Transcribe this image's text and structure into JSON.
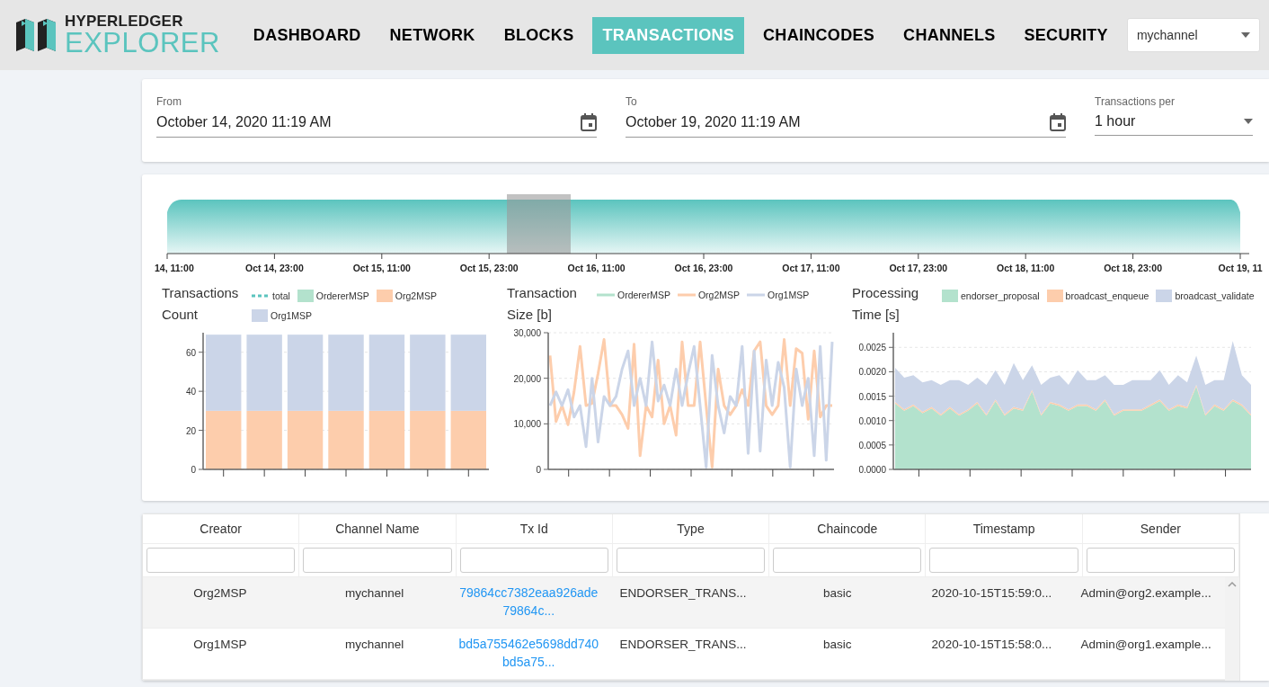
{
  "header": {
    "logo": {
      "top": "HYPERLEDGER",
      "bottom": "EXPLORER"
    },
    "nav": [
      {
        "label": "DASHBOARD",
        "selected": false
      },
      {
        "label": "NETWORK",
        "selected": false
      },
      {
        "label": "BLOCKS",
        "selected": false
      },
      {
        "label": "TRANSACTIONS",
        "selected": true
      },
      {
        "label": "CHAINCODES",
        "selected": false
      },
      {
        "label": "CHANNELS",
        "selected": false
      },
      {
        "label": "SECURITY",
        "selected": false
      }
    ],
    "channel_select": {
      "value": "mychannel"
    }
  },
  "filters": {
    "from": {
      "label": "From",
      "value": "October 14, 2020 11:19 AM"
    },
    "to": {
      "label": "To",
      "value": "October 19, 2020 11:19 AM"
    },
    "per": {
      "label": "Transactions per",
      "value": "1 hour"
    }
  },
  "timeline": {
    "ticks": [
      "14, 11:00",
      "Oct 14, 23:00",
      "Oct 15, 11:00",
      "Oct 15, 23:00",
      "Oct 16, 11:00",
      "Oct 16, 23:00",
      "Oct 17, 11:00",
      "Oct 17, 23:00",
      "Oct 18, 11:00",
      "Oct 18, 23:00",
      "Oct 19, 11"
    ]
  },
  "charts": [
    {
      "chart_data": {
        "type": "bar",
        "title": "Transactions Count",
        "stacked": true,
        "grid": true,
        "legend": "top",
        "ylim": [
          0,
          70
        ],
        "yticks": [
          0,
          20,
          40,
          60
        ],
        "ref_lines": [
          {
            "label": "total",
            "color": "#5bc4be"
          }
        ],
        "series": [
          {
            "name": "OrdererMSP",
            "color": "#b3e2cd",
            "values": [
              0,
              0,
              0,
              0,
              0,
              0,
              0
            ]
          },
          {
            "name": "Org2MSP",
            "color": "#fdcdac",
            "values": [
              30,
              30,
              30,
              30,
              30,
              30,
              30
            ]
          },
          {
            "name": "Org1MSP",
            "color": "#cbd5e8",
            "values": [
              39,
              39,
              39,
              39,
              39,
              39,
              39
            ]
          }
        ]
      }
    },
    {
      "chart_data": {
        "type": "line",
        "title": "Transaction Size [b]",
        "grid": true,
        "legend": "top",
        "ylim": [
          0,
          30000
        ],
        "yticks": [
          {
            "value": 0,
            "label": "0"
          },
          {
            "value": 10000,
            "label": "10,000"
          },
          {
            "value": 20000,
            "label": "20,000"
          },
          {
            "value": 30000,
            "label": "30,000"
          }
        ],
        "series": [
          {
            "name": "OrdererMSP",
            "color": "#b3e2cd",
            "values": [
              null,
              null,
              null,
              null,
              null,
              null,
              null,
              null,
              null,
              null,
              null,
              null,
              null,
              null,
              null,
              null,
              null,
              null,
              null,
              null,
              null,
              null,
              null,
              null,
              null,
              null,
              null,
              null,
              null,
              null,
              null,
              null,
              null,
              null,
              null,
              null,
              null,
              null,
              null,
              null,
              null,
              null,
              null,
              null,
              null,
              null,
              null,
              null
            ]
          },
          {
            "name": "Org2MSP",
            "color": "#fdcdac",
            "values": [
              25000,
              10500,
              14000,
              9800,
              17000,
              27000,
              14000,
              14500,
              21000,
              28500,
              14000,
              14000,
              12000,
              9000,
              27500,
              3000,
              14000,
              11500,
              24000,
              10000,
              14000,
              7500,
              28000,
              14000,
              14000,
              28000,
              14000,
              500,
              22000,
              14000,
              12000,
              14000,
              17500,
              14000,
              26000,
              28000,
              14000,
              12000,
              14000,
              28500,
              14000,
              26500,
              25500,
              11000,
              26000,
              11500,
              14000,
              14000
            ]
          },
          {
            "name": "Org1MSP",
            "color": "#cbd5e8",
            "values": [
              14000,
              17000,
              14000,
              17500,
              11500,
              14000,
              5000,
              20000,
              6000,
              16000,
              14000,
              16000,
              22000,
              26000,
              14000,
              20000,
              14000,
              28000,
              15000,
              18500,
              14000,
              22000,
              14000,
              21000,
              27000,
              14000,
              500,
              25000,
              14000,
              8000,
              16000,
              14000,
              27000,
              3500,
              26000,
              4000,
              24000,
              14000,
              23500,
              18000,
              500,
              22000,
              14000,
              20000,
              3000,
              27000,
              2000,
              28000
            ]
          }
        ]
      }
    },
    {
      "chart_data": {
        "type": "area",
        "title": "Processing Time [s]",
        "stacked": true,
        "grid": true,
        "legend": "top",
        "ylim": [
          0,
          0.0028
        ],
        "yticks": [
          {
            "value": 0,
            "label": "0.0000"
          },
          {
            "value": 0.0005,
            "label": "0.0005"
          },
          {
            "value": 0.001,
            "label": "0.0010"
          },
          {
            "value": 0.0015,
            "label": "0.0015"
          },
          {
            "value": 0.002,
            "label": "0.0020"
          },
          {
            "value": 0.0025,
            "label": "0.0025"
          }
        ],
        "series": [
          {
            "name": "endorser_proposal",
            "color": "#b3e2cd",
            "values": [
              0.00135,
              0.0012,
              0.0013,
              0.00115,
              0.00125,
              0.0011,
              0.00125,
              0.0011,
              0.0012,
              0.00135,
              0.0011,
              0.0014,
              0.0011,
              0.00125,
              0.0012,
              0.0016,
              0.0011,
              0.00135,
              0.0013,
              0.0012,
              0.0013,
              0.0013,
              0.0012,
              0.0014,
              0.0011,
              0.0012,
              0.0012,
              0.0012,
              0.0013,
              0.0014,
              0.0012,
              0.0013,
              0.00125,
              0.0017,
              0.0011,
              0.0013,
              0.0012,
              0.0014,
              0.0013,
              0.0011
            ]
          },
          {
            "name": "broadcast_enqueue",
            "color": "#fdcdac",
            "values": [
              3e-05,
              3e-05,
              3e-05,
              3e-05,
              3e-05,
              3e-05,
              3e-05,
              3e-05,
              3e-05,
              3e-05,
              3e-05,
              3e-05,
              3e-05,
              3e-05,
              3e-05,
              3e-05,
              3e-05,
              3e-05,
              3e-05,
              3e-05,
              3e-05,
              3e-05,
              3e-05,
              3e-05,
              3e-05,
              3e-05,
              3e-05,
              3e-05,
              3e-05,
              3e-05,
              3e-05,
              3e-05,
              3e-05,
              3e-05,
              3e-05,
              3e-05,
              3e-05,
              3e-05,
              3e-05,
              3e-05
            ]
          },
          {
            "name": "broadcast_validate",
            "color": "#cbd5e8",
            "values": [
              0.0007,
              0.00065,
              0.0006,
              0.0006,
              0.00055,
              0.0006,
              0.00055,
              0.0007,
              0.0005,
              0.0005,
              0.0006,
              0.0006,
              0.0006,
              0.0009,
              0.0006,
              0.0005,
              0.0006,
              0.0005,
              0.0006,
              0.0005,
              0.0007,
              0.0005,
              0.0006,
              0.0005,
              0.0006,
              0.0005,
              0.0006,
              0.0006,
              0.0005,
              0.0006,
              0.0005,
              0.0006,
              0.0005,
              0.0006,
              0.0006,
              0.0005,
              0.0006,
              0.0012,
              0.0006,
              0.0006
            ]
          }
        ]
      }
    }
  ],
  "table": {
    "columns": [
      "Creator",
      "Channel Name",
      "Tx Id",
      "Type",
      "Chaincode",
      "Timestamp",
      "Sender"
    ],
    "rows": [
      {
        "creator": "Org2MSP",
        "channel_name": "mychannel",
        "tx_id": [
          "79864cc7382eaa926ade",
          "79864c..."
        ],
        "type": "ENDORSER_TRANS...",
        "chaincode": "basic",
        "timestamp": "2020-10-15T15:59:0...",
        "sender": "Admin@org2.example..."
      },
      {
        "creator": "Org1MSP",
        "channel_name": "mychannel",
        "tx_id": [
          "bd5a755462e5698dd740",
          "bd5a75..."
        ],
        "type": "ENDORSER_TRANS...",
        "chaincode": "basic",
        "timestamp": "2020-10-15T15:58:0...",
        "sender": "Admin@org1.example..."
      }
    ]
  }
}
